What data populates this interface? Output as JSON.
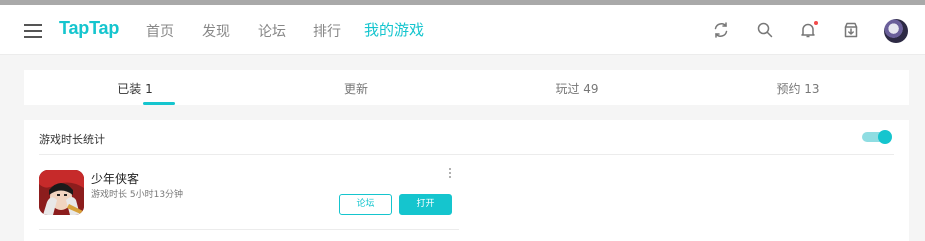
{
  "header": {
    "logo": "TapTap",
    "nav": [
      "首页",
      "发现",
      "论坛",
      "排行",
      "我的游戏"
    ],
    "active_nav": "我的游戏",
    "icons": [
      "refresh-icon",
      "search-icon",
      "bell-icon",
      "download-icon"
    ],
    "accent_color": "#15c5ce"
  },
  "tabs": {
    "items": [
      "已装 1",
      "更新",
      "玩过 49",
      "预约 13"
    ],
    "active": "已装 1"
  },
  "section": {
    "title": "游戏时长统计",
    "toggle_on": true
  },
  "games": [
    {
      "name": "少年侠客",
      "playtime": "游戏时长 5小时13分钟",
      "forum_label": "论坛",
      "open_label": "打开"
    }
  ]
}
